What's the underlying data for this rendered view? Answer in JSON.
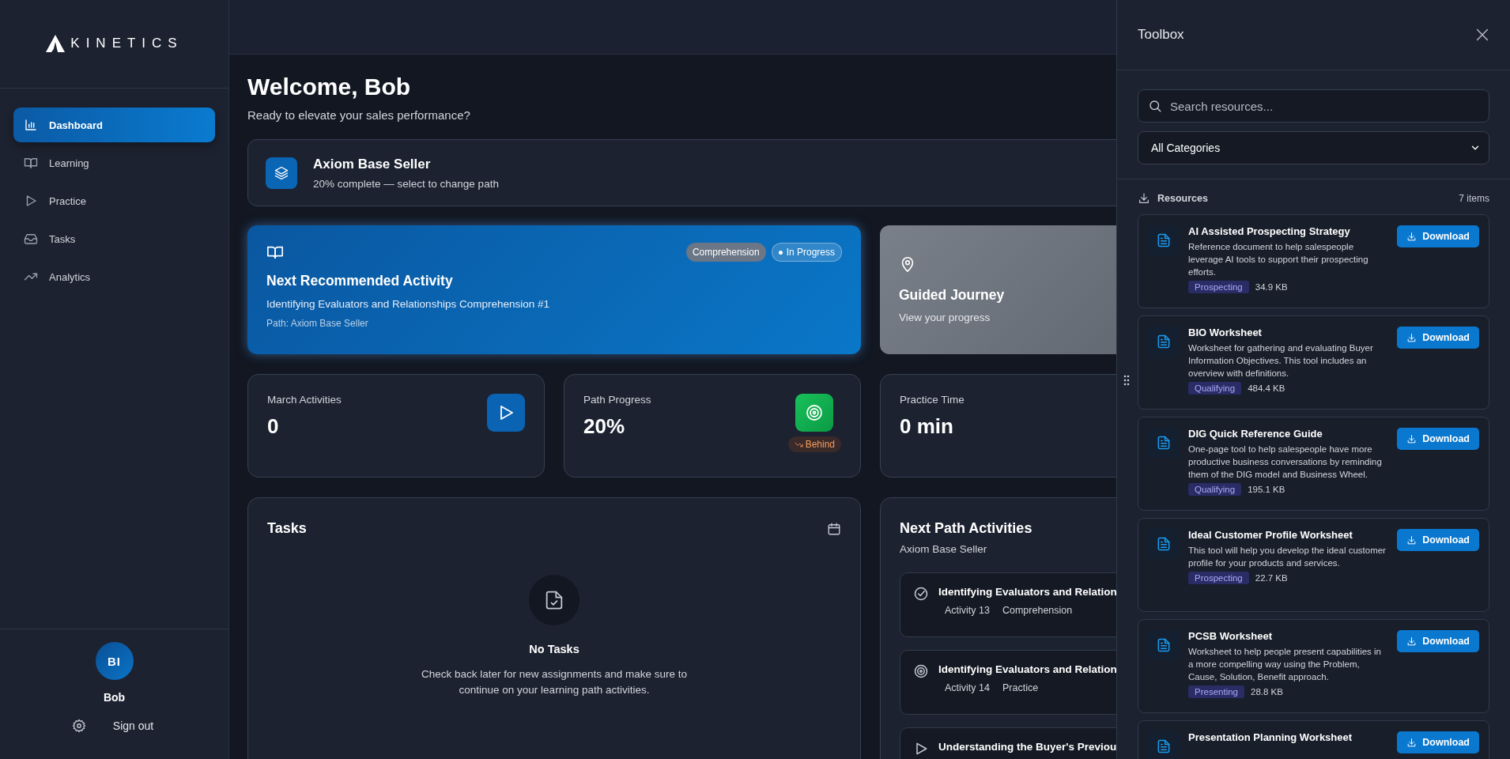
{
  "brand": {
    "name": "KINETICS"
  },
  "sidebar": {
    "items": [
      {
        "label": "Dashboard",
        "selected": true
      },
      {
        "label": "Learning",
        "selected": false
      },
      {
        "label": "Practice",
        "selected": false
      },
      {
        "label": "Tasks",
        "selected": false
      },
      {
        "label": "Analytics",
        "selected": false
      }
    ]
  },
  "user": {
    "initials": "BI",
    "name": "Bob",
    "sign_out": "Sign out"
  },
  "header": {
    "title": "Welcome, Bob",
    "subtitle": "Ready to elevate your sales performance?"
  },
  "path_card": {
    "title": "Axiom Base Seller",
    "subtitle": "20% complete — select to change path"
  },
  "recommended": {
    "title": "Next Recommended Activity",
    "activity": "Identifying Evaluators and Relationships Comprehension #1",
    "path": "Path: Axiom Base Seller",
    "tags": [
      {
        "label": "Comprehension",
        "kind": "category"
      },
      {
        "label": "In Progress",
        "kind": "status"
      }
    ]
  },
  "journey": {
    "title": "Guided Journey",
    "subtitle": "View your progress"
  },
  "stats": [
    {
      "label": "March Activities",
      "value": "0"
    },
    {
      "label": "Path Progress",
      "value": "20%",
      "badge": "Behind"
    },
    {
      "label": "Practice Time",
      "value": "0 min"
    }
  ],
  "tasks": {
    "title": "Tasks",
    "empty_title": "No Tasks",
    "empty_text": "Check back later for new assignments and make sure to continue on your learning path activities."
  },
  "next_path": {
    "title": "Next Path Activities",
    "subtitle": "Axiom Base Seller",
    "items": [
      {
        "title": "Identifying Evaluators and Relation",
        "activity": "Activity 13",
        "type": "Comprehension"
      },
      {
        "title": "Identifying Evaluators and Relation",
        "activity": "Activity 14",
        "type": "Practice"
      },
      {
        "title": "Understanding the Buyer's Previou"
      }
    ]
  },
  "toolbox": {
    "title": "Toolbox",
    "search": {
      "placeholder": "Search resources..."
    },
    "category": "All Categories",
    "section": "Resources",
    "count": "7 items",
    "items": [
      {
        "title": "AI Assisted Prospecting Strategy",
        "description": "Reference document to help salespeople leverage AI tools to support their prospecting efforts.",
        "tag": "Prospecting",
        "size": "34.9 KB",
        "button": "Download"
      },
      {
        "title": "BIO Worksheet",
        "description": "Worksheet for gathering and evaluating Buyer Information Objectives. This tool includes an overview with definitions.",
        "tag": "Qualifying",
        "size": "484.4 KB",
        "button": "Download"
      },
      {
        "title": "DIG Quick Reference Guide",
        "description": "One-page tool to help salespeople have more productive business conversations by reminding them of the DIG model and Business Wheel.",
        "tag": "Qualifying",
        "size": "195.1 KB",
        "button": "Download"
      },
      {
        "title": "Ideal Customer Profile Worksheet",
        "description": "This tool will help you develop the ideal customer profile for your products and services.",
        "tag": "Prospecting",
        "size": "22.7 KB",
        "button": "Download"
      },
      {
        "title": "PCSB Worksheet",
        "description": "Worksheet to help people present capabilities in a more compelling way using the Problem, Cause, Solution, Benefit approach.",
        "tag": "Presenting",
        "size": "28.8 KB",
        "button": "Download"
      },
      {
        "title": "Presentation Planning Worksheet",
        "button": "Download"
      }
    ]
  }
}
